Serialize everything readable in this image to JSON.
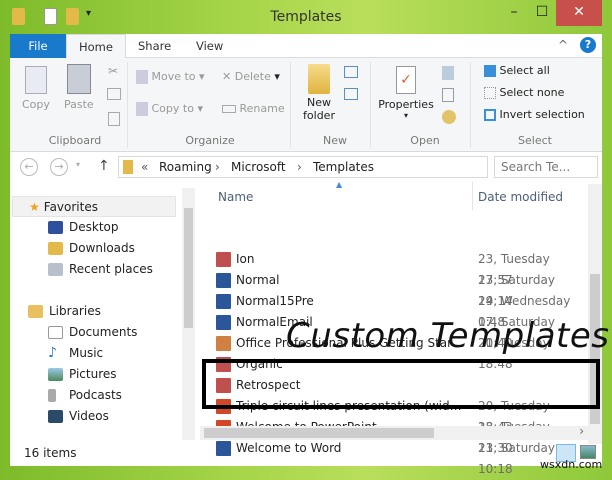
{
  "window": {
    "title": "Templates",
    "minimize": "–",
    "maximize": "☐",
    "close": "✕"
  },
  "tabs": [
    {
      "label": "File"
    },
    {
      "label": "Home"
    },
    {
      "label": "Share"
    },
    {
      "label": "View"
    }
  ],
  "ribbon": {
    "clipboard": {
      "label": "Clipboard",
      "copy": "Copy",
      "paste": "Paste"
    },
    "organize": {
      "label": "Organize",
      "move_to": "Move to",
      "copy_to": "Copy to",
      "delete": "Delete",
      "rename": "Rename"
    },
    "new": {
      "label": "New",
      "new_folder": "New folder"
    },
    "open": {
      "label": "Open",
      "properties": "Properties"
    },
    "select": {
      "label": "Select",
      "select_all": "Select all",
      "select_none": "Select none",
      "invert": "Invert selection"
    }
  },
  "address": {
    "crumbs": [
      "Roaming",
      "Microsoft",
      "Templates"
    ],
    "overflow": "«",
    "search_placeholder": "Search Te..."
  },
  "nav": {
    "favorites": {
      "label": "Favorites",
      "items": [
        {
          "label": "Desktop"
        },
        {
          "label": "Downloads"
        },
        {
          "label": "Recent places"
        }
      ]
    },
    "libraries": {
      "label": "Libraries",
      "items": [
        {
          "label": "Documents"
        },
        {
          "label": "Music"
        },
        {
          "label": "Pictures"
        },
        {
          "label": "Podcasts"
        },
        {
          "label": "Videos"
        }
      ]
    }
  },
  "list": {
    "columns": {
      "name": "Name",
      "date": "Date modified"
    },
    "files": [
      {
        "name": "Ion",
        "date": "23, Tuesday 23:57",
        "type": "potx-theme"
      },
      {
        "name": "Normal",
        "date": "17, Saturday 19:14",
        "type": "word"
      },
      {
        "name": "Normal15Pre",
        "date": "24, Wednesday 0:48",
        "type": "word"
      },
      {
        "name": "NormalEmail",
        "date": "17, Saturday 21:40",
        "type": "word"
      },
      {
        "name": "Office Professional Plus Getting Started",
        "date": "20, Tuesday 18:48",
        "type": "generic"
      },
      {
        "name": "Organic",
        "date": "",
        "type": "potx-theme"
      },
      {
        "name": "Retrospect",
        "date": "",
        "type": "potx-theme"
      },
      {
        "name": "Triple circuit lines presentation (widescre...",
        "date": "20, Tuesday 18:43",
        "type": "powerpoint"
      },
      {
        "name": "Welcome to PowerPoint",
        "date": "23, Tuesday 23:30",
        "type": "powerpoint"
      },
      {
        "name": "Welcome to Word",
        "date": "11, Saturday 10:18",
        "type": "word"
      }
    ]
  },
  "status": {
    "count": "16 items"
  },
  "overlay": {
    "caption": "Custom Templates"
  },
  "watermark": "wsxdn.com",
  "colors": {
    "accent": "#1979ca",
    "word": "#2b579a",
    "powerpoint": "#d24726",
    "close": "#c7504a"
  }
}
